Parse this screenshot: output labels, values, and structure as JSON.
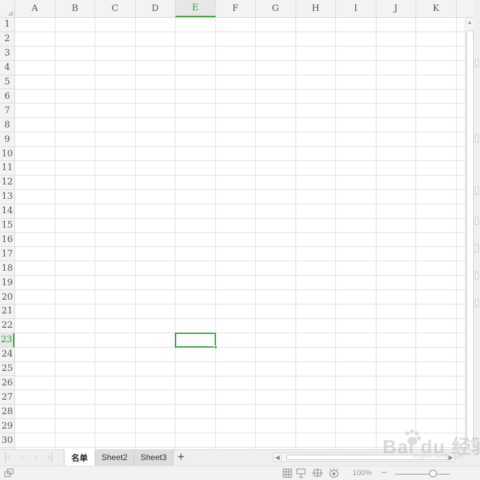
{
  "columns": [
    "A",
    "B",
    "C",
    "D",
    "E",
    "F",
    "G",
    "H",
    "I",
    "J",
    "K"
  ],
  "rows": [
    "1",
    "2",
    "3",
    "4",
    "5",
    "6",
    "7",
    "8",
    "9",
    "10",
    "11",
    "12",
    "13",
    "14",
    "15",
    "16",
    "17",
    "18",
    "19",
    "20",
    "21",
    "22",
    "23",
    "24",
    "25",
    "26",
    "27",
    "28",
    "29",
    "30"
  ],
  "selection": {
    "column": "E",
    "row": "23"
  },
  "sheet_tabs": [
    {
      "label": "名单",
      "active": true
    },
    {
      "label": "Sheet2",
      "active": false
    },
    {
      "label": "Sheet3",
      "active": false
    }
  ],
  "add_sheet_label": "+",
  "status_bar": {
    "zoom": "100%",
    "zoom_minus": "−"
  },
  "watermark": {
    "text": "Bai du 经验",
    "sub": "jingyan.baidu.com"
  },
  "colors": {
    "accent": "#3aa34a",
    "grid": "#e1e1e1",
    "header_bg": "#f3f3f3"
  },
  "icons": [
    "nav-first-icon",
    "nav-prev-icon",
    "nav-next-icon",
    "nav-last-icon",
    "normal-view-icon",
    "page-break-view-icon",
    "page-layout-view-icon",
    "eye-protection-icon"
  ]
}
